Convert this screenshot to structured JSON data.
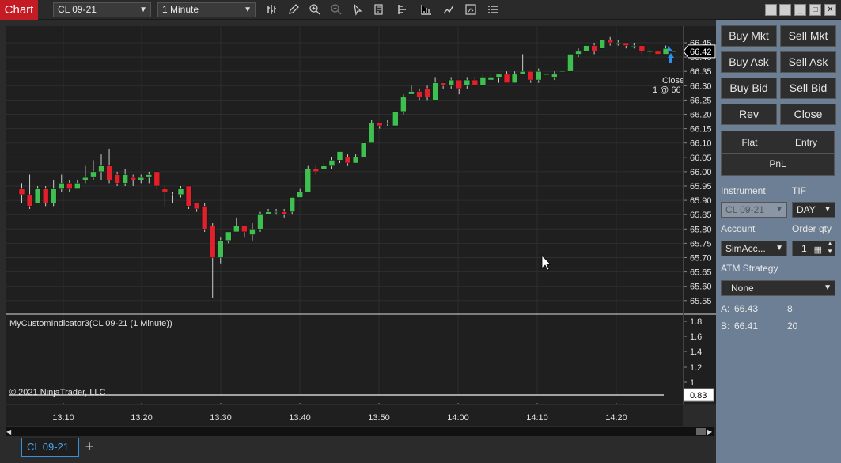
{
  "app": {
    "badge": "Chart"
  },
  "toolbar": {
    "instrument": "CL 09-21",
    "interval": "1 Minute",
    "icons": [
      "bar-type-icon",
      "draw-pencil-icon",
      "zoom-in-icon",
      "zoom-out-icon",
      "cursor-icon",
      "data-box-icon",
      "properties-icon",
      "indicators-icon",
      "strategies-icon",
      "templates-icon",
      "menu-icon"
    ]
  },
  "chart": {
    "price_labels": [
      "66.45",
      "66.40",
      "66.35",
      "66.30",
      "66.25",
      "66.20",
      "66.15",
      "66.10",
      "66.05",
      "66.00",
      "65.95",
      "65.90",
      "65.85",
      "65.80",
      "65.75",
      "65.70",
      "65.65",
      "65.60",
      "65.55"
    ],
    "last_price": "66.42",
    "position_label_1": "Close",
    "position_label_2": "1 @ 66",
    "indicator_title": "MyCustomIndicator3(CL 09-21 (1 Minute))",
    "indicator_labels": [
      "1.8",
      "1.6",
      "1.4",
      "1.2",
      "1"
    ],
    "indicator_value": "0.83",
    "copyright": "© 2021 NinjaTrader, LLC",
    "time_labels": [
      "13:10",
      "13:20",
      "13:30",
      "13:40",
      "13:50",
      "14:00",
      "14:10",
      "14:20"
    ],
    "colors": {
      "up": "#3fbf4f",
      "down": "#e0202a",
      "background": "#1f1f1f",
      "grid": "#2e2e2e"
    }
  },
  "chart_data": {
    "type": "candlestick",
    "xlabel": "",
    "ylabel": "",
    "ylim": [
      65.52,
      66.48
    ],
    "candles": [
      [
        65.94,
        65.92,
        65.96,
        65.89
      ],
      [
        65.92,
        65.88,
        65.99,
        65.87
      ],
      [
        65.89,
        65.94,
        65.95,
        65.89
      ],
      [
        65.94,
        65.89,
        65.95,
        65.88
      ],
      [
        65.89,
        65.94,
        65.97,
        65.88
      ],
      [
        65.94,
        65.96,
        65.99,
        65.93
      ],
      [
        65.96,
        65.94,
        65.97,
        65.93
      ],
      [
        65.94,
        65.96,
        65.97,
        65.94
      ],
      [
        65.97,
        65.98,
        66.02,
        65.96
      ],
      [
        65.98,
        66.0,
        66.04,
        65.97
      ],
      [
        66.0,
        66.02,
        66.06,
        65.97
      ],
      [
        66.02,
        65.97,
        66.08,
        65.96
      ],
      [
        65.99,
        65.96,
        66.0,
        65.95
      ],
      [
        65.96,
        65.99,
        66.01,
        65.95
      ],
      [
        65.98,
        65.97,
        65.99,
        65.95
      ],
      [
        65.97,
        65.98,
        65.99,
        65.96
      ],
      [
        65.98,
        65.99,
        66.0,
        65.96
      ],
      [
        66.0,
        65.95,
        66.0,
        65.94
      ],
      [
        65.94,
        65.93,
        65.95,
        65.88
      ],
      [
        65.92,
        65.92,
        65.93,
        65.89
      ],
      [
        65.92,
        65.94,
        65.95,
        65.91
      ],
      [
        65.95,
        65.88,
        65.95,
        65.87
      ],
      [
        65.89,
        65.87,
        65.89,
        65.86
      ],
      [
        65.88,
        65.8,
        65.89,
        65.79
      ],
      [
        65.81,
        65.7,
        65.82,
        65.56
      ],
      [
        65.7,
        65.76,
        65.77,
        65.68
      ],
      [
        65.76,
        65.79,
        65.79,
        65.75
      ],
      [
        65.79,
        65.81,
        65.84,
        65.79
      ],
      [
        65.81,
        65.79,
        65.81,
        65.77
      ],
      [
        65.78,
        65.8,
        65.82,
        65.76
      ],
      [
        65.8,
        65.85,
        65.86,
        65.79
      ],
      [
        65.85,
        65.86,
        65.87,
        65.85
      ],
      [
        65.86,
        65.86,
        65.87,
        65.85
      ],
      [
        65.86,
        65.85,
        65.87,
        65.84
      ],
      [
        65.86,
        65.91,
        65.91,
        65.85
      ],
      [
        65.91,
        65.93,
        65.94,
        65.91
      ],
      [
        65.93,
        66.01,
        66.02,
        65.93
      ],
      [
        66.01,
        66.0,
        66.02,
        65.99
      ],
      [
        66.01,
        66.02,
        66.03,
        66.01
      ],
      [
        66.02,
        66.04,
        66.05,
        66.01
      ],
      [
        66.04,
        66.07,
        66.07,
        66.03
      ],
      [
        66.05,
        66.03,
        66.06,
        66.02
      ],
      [
        66.03,
        66.05,
        66.06,
        66.03
      ],
      [
        66.05,
        66.1,
        66.1,
        66.05
      ],
      [
        66.1,
        66.17,
        66.18,
        66.1
      ],
      [
        66.17,
        66.16,
        66.17,
        66.15
      ],
      [
        66.17,
        66.17,
        66.18,
        66.16
      ],
      [
        66.16,
        66.21,
        66.21,
        66.16
      ],
      [
        66.21,
        66.26,
        66.27,
        66.2
      ],
      [
        66.27,
        66.28,
        66.3,
        66.27
      ],
      [
        66.28,
        66.26,
        66.29,
        66.25
      ],
      [
        66.29,
        66.26,
        66.3,
        66.25
      ],
      [
        66.25,
        66.31,
        66.33,
        66.25
      ],
      [
        66.31,
        66.3,
        66.31,
        66.29
      ],
      [
        66.3,
        66.32,
        66.33,
        66.29
      ],
      [
        66.32,
        66.29,
        66.32,
        66.27
      ],
      [
        66.3,
        66.32,
        66.33,
        66.29
      ],
      [
        66.32,
        66.3,
        66.33,
        66.3
      ],
      [
        66.3,
        66.33,
        66.34,
        66.3
      ],
      [
        66.32,
        66.33,
        66.34,
        66.32
      ],
      [
        66.33,
        66.34,
        66.34,
        66.31
      ],
      [
        66.34,
        66.31,
        66.35,
        66.31
      ],
      [
        66.31,
        66.34,
        66.35,
        66.31
      ],
      [
        66.34,
        66.35,
        66.41,
        66.34
      ],
      [
        66.35,
        66.32,
        66.35,
        66.31
      ],
      [
        66.32,
        66.35,
        66.36,
        66.31
      ],
      [
        66.34,
        66.34,
        66.34,
        66.34
      ],
      [
        66.33,
        66.34,
        66.35,
        66.32
      ],
      [
        66.35,
        66.35,
        66.35,
        66.35
      ],
      [
        66.35,
        66.41,
        66.41,
        66.35
      ],
      [
        66.41,
        66.42,
        66.43,
        66.4
      ],
      [
        66.42,
        66.44,
        66.44,
        66.42
      ],
      [
        66.44,
        66.42,
        66.45,
        66.41
      ],
      [
        66.43,
        66.46,
        66.46,
        66.43
      ],
      [
        66.46,
        66.45,
        66.47,
        66.44
      ],
      [
        66.45,
        66.45,
        66.46,
        66.44
      ],
      [
        66.45,
        66.44,
        66.45,
        66.43
      ],
      [
        66.44,
        66.44,
        66.45,
        66.43
      ],
      [
        66.44,
        66.42,
        66.44,
        66.41
      ],
      [
        66.42,
        66.42,
        66.43,
        66.39
      ],
      [
        66.42,
        66.41,
        66.42,
        66.41
      ],
      [
        66.41,
        66.43,
        66.44,
        66.41
      ],
      [
        66.42,
        66.42,
        66.42,
        66.42
      ]
    ]
  },
  "sidepanel": {
    "buttons": {
      "buy_mkt": "Buy Mkt",
      "sell_mkt": "Sell Mkt",
      "buy_ask": "Buy Ask",
      "sell_ask": "Sell Ask",
      "buy_bid": "Buy Bid",
      "sell_bid": "Sell Bid",
      "rev": "Rev",
      "close": "Close",
      "flat": "Flat",
      "entry": "Entry",
      "pnl": "PnL"
    },
    "instrument_label": "Instrument",
    "tif_label": "TIF",
    "instrument_value": "CL 09-21",
    "tif_value": "DAY",
    "account_label": "Account",
    "order_qty_label": "Order qty",
    "account_value": "SimAcc...",
    "order_qty_value": "1",
    "atm_label": "ATM Strategy",
    "atm_value": "None",
    "ask_prefix": "A:",
    "ask_price": "66.43",
    "ask_size": "8",
    "bid_prefix": "B:",
    "bid_price": "66.41",
    "bid_size": "20"
  },
  "tabs": {
    "active": "CL 09-21",
    "add": "+"
  }
}
